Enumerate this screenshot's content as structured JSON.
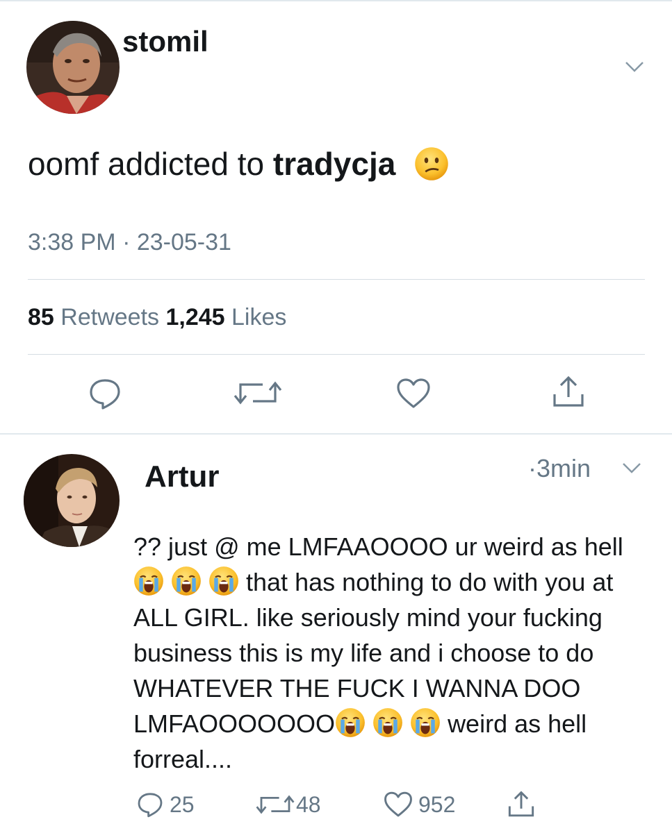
{
  "main_tweet": {
    "author": "stomil",
    "text_plain": "oomf addicted to ",
    "text_bold": "tradycja",
    "emoji": "confused-face",
    "timestamp": "3:38 PM · 23-05-31",
    "retweets_count": "85",
    "retweets_label": "Retweets",
    "likes_count": "1,245",
    "likes_label": "Likes"
  },
  "reply": {
    "author": "Artur",
    "time": "·3min",
    "text_part1": "?? just @ me LMFAAOOOO ur weird as hell",
    "text_part2": "that has nothing to do with you at ALL GIRL. like seriously mind your fucking business this is my life and i choose to do WHATEVER THE FUCK I WANNA DOO LMFAOOOOOOO",
    "text_part3": "weird as hell forreal....",
    "emoji": "loudly-crying-face",
    "reply_count": "25",
    "retweet_count": "48",
    "like_count": "952"
  },
  "colors": {
    "text": "#14171a",
    "secondary": "#657786",
    "divider": "#e1e8ed",
    "icon": "#657786"
  }
}
